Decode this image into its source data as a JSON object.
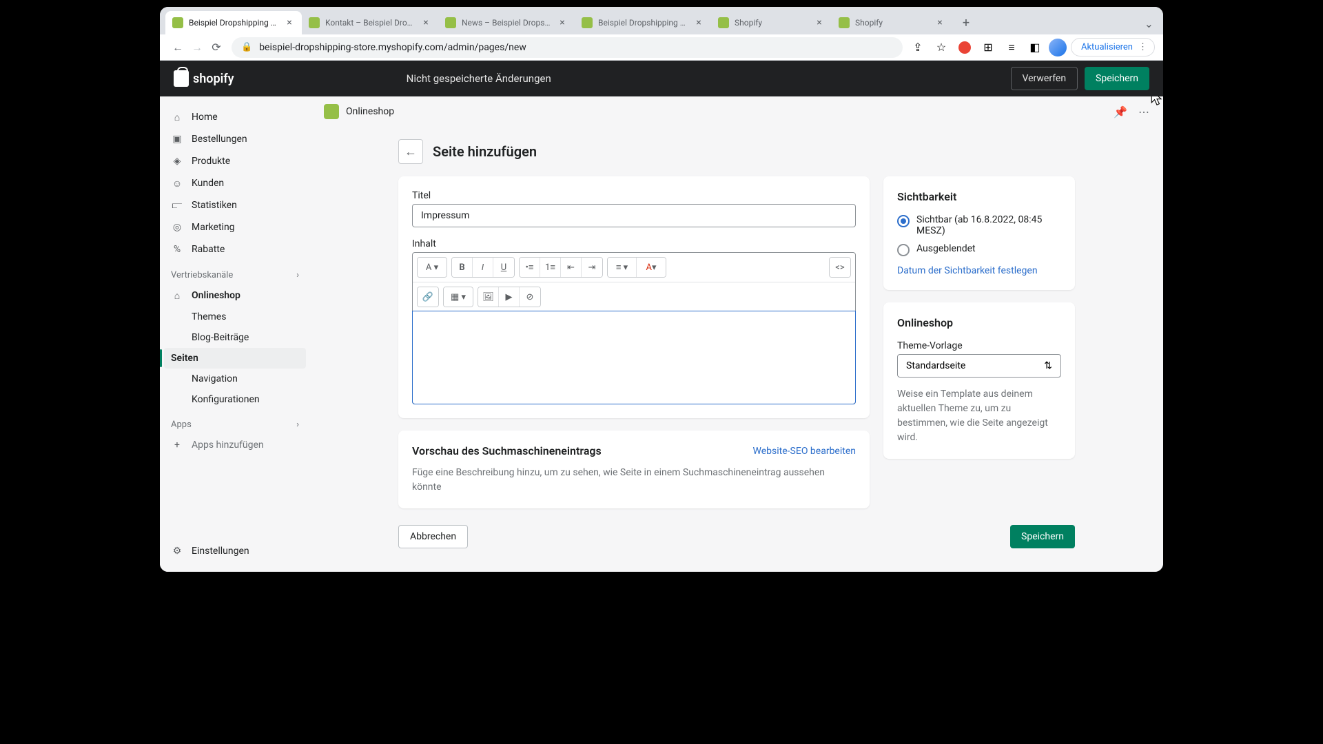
{
  "browser": {
    "tabs": [
      {
        "label": "Beispiel Dropshipping Store",
        "active": true
      },
      {
        "label": "Kontakt – Beispiel Dropship",
        "active": false
      },
      {
        "label": "News – Beispiel Dropshipp",
        "active": false
      },
      {
        "label": "Beispiel Dropshipping Store",
        "active": false
      },
      {
        "label": "Shopify",
        "active": false
      },
      {
        "label": "Shopify",
        "active": false
      }
    ],
    "url": "beispiel-dropshipping-store.myshopify.com/admin/pages/new",
    "update_label": "Aktualisieren"
  },
  "appbar": {
    "logo": "shopify",
    "unsaved": "Nicht gespeicherte Änderungen",
    "discard": "Verwerfen",
    "save": "Speichern"
  },
  "sidebar": {
    "items": [
      "Home",
      "Bestellungen",
      "Produkte",
      "Kunden",
      "Statistiken",
      "Marketing",
      "Rabatte"
    ],
    "channels_label": "Vertriebskanäle",
    "onlineshop": "Onlineshop",
    "onlineshop_sub": [
      "Themes",
      "Blog-Beiträge",
      "Seiten",
      "Navigation",
      "Konfigurationen"
    ],
    "apps_label": "Apps",
    "add_apps": "Apps hinzufügen",
    "settings": "Einstellungen"
  },
  "breadcrumb": {
    "shop": "Onlineshop"
  },
  "page": {
    "title": "Seite hinzufügen",
    "titel_label": "Titel",
    "titel_value": "Impressum",
    "inhalt_label": "Inhalt"
  },
  "seo": {
    "heading": "Vorschau des Suchmaschineneintrags",
    "edit": "Website-SEO bearbeiten",
    "desc": "Füge eine Beschreibung hinzu, um zu sehen, wie Seite in einem Suchmaschineneintrag aussehen könnte"
  },
  "visibility": {
    "heading": "Sichtbarkeit",
    "visible": "Sichtbar (ab 16.8.2022, 08:45 MESZ)",
    "hidden": "Ausgeblendet",
    "set_date": "Datum der Sichtbarkeit festlegen"
  },
  "template": {
    "heading": "Onlineshop",
    "label": "Theme-Vorlage",
    "value": "Standardseite",
    "help": "Weise ein Template aus deinem aktuellen Theme zu, um zu bestimmen, wie die Seite angezeigt wird."
  },
  "footer": {
    "cancel": "Abbrechen",
    "save": "Speichern"
  }
}
